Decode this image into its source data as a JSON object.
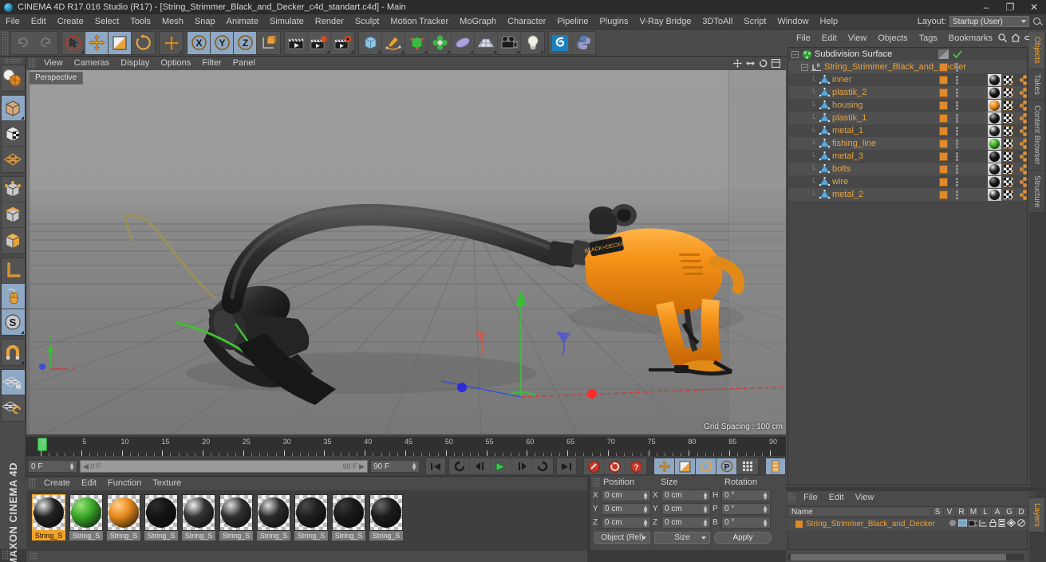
{
  "window": {
    "title": "CINEMA 4D R17.016 Studio (R17) - [String_Strimmer_Black_and_Decker_c4d_standart.c4d] - Main",
    "app_icon": "cinema4d-logo-icon",
    "minimize": "–",
    "maximize": "❐",
    "close": "✕"
  },
  "menubar": {
    "items": [
      "File",
      "Edit",
      "Create",
      "Select",
      "Tools",
      "Mesh",
      "Snap",
      "Animate",
      "Simulate",
      "Render",
      "Sculpt",
      "Motion Tracker",
      "MoGraph",
      "Character",
      "Pipeline",
      "Plugins",
      "V-Ray Bridge",
      "3DToAll",
      "Script",
      "Window",
      "Help"
    ],
    "layout_label": "Layout:",
    "layout_value": "Startup (User)"
  },
  "toolbar": {
    "groups": [
      {
        "name": "undo-redo",
        "buttons": [
          {
            "name": "undo-button",
            "icon": "undo-icon",
            "active": false,
            "disabled": true
          },
          {
            "name": "redo-button",
            "icon": "redo-icon",
            "active": false,
            "disabled": true
          }
        ]
      },
      {
        "name": "selection-transform",
        "buttons": [
          {
            "name": "live-selection-tool",
            "icon": "cursor-circle-icon",
            "active": false,
            "disabled": false
          },
          {
            "name": "move-tool",
            "icon": "move-arrows-icon",
            "active": true,
            "disabled": false
          },
          {
            "name": "scale-tool",
            "icon": "scale-box-icon",
            "active": true,
            "disabled": false
          },
          {
            "name": "rotate-tool",
            "icon": "rotate-circle-icon",
            "active": false,
            "disabled": false
          }
        ]
      },
      {
        "name": "world-axis",
        "buttons": [
          {
            "name": "global-local-toggle",
            "icon": "plus-axis-icon",
            "active": false,
            "disabled": false
          }
        ]
      },
      {
        "name": "axis-locks",
        "buttons": [
          {
            "name": "x-axis-lock",
            "icon": "x-axis-icon",
            "active": true,
            "disabled": false
          },
          {
            "name": "y-axis-lock",
            "icon": "y-axis-icon",
            "active": true,
            "disabled": false
          },
          {
            "name": "z-axis-lock",
            "icon": "z-axis-icon",
            "active": true,
            "disabled": false
          },
          {
            "name": "world-object-coord",
            "icon": "world-cube-icon",
            "active": false,
            "disabled": false
          }
        ]
      },
      {
        "name": "render",
        "buttons": [
          {
            "name": "render-view-button",
            "icon": "render-clapper-icon",
            "active": false,
            "disabled": false
          },
          {
            "name": "render-region-button",
            "icon": "render-region-icon",
            "active": false,
            "disabled": false
          },
          {
            "name": "render-settings-button",
            "icon": "render-settings-icon",
            "active": false,
            "disabled": false
          }
        ]
      },
      {
        "name": "create",
        "buttons": [
          {
            "name": "add-primitive-button",
            "icon": "cube-icon",
            "active": false,
            "disabled": false
          },
          {
            "name": "add-spline-button",
            "icon": "pen-spline-icon",
            "active": false,
            "disabled": false
          },
          {
            "name": "add-generator-button",
            "icon": "generator-icon",
            "active": false,
            "disabled": false
          },
          {
            "name": "add-mograph-button",
            "icon": "mograph-cloner-icon",
            "active": false,
            "disabled": false
          },
          {
            "name": "add-deformer-button",
            "icon": "deformer-icon",
            "active": false,
            "disabled": false
          },
          {
            "name": "add-scene-button",
            "icon": "floor-scene-icon",
            "active": false,
            "disabled": false
          },
          {
            "name": "add-camera-button",
            "icon": "camera-icon",
            "active": false,
            "disabled": false
          },
          {
            "name": "add-light-button",
            "icon": "light-bulb-icon",
            "active": false,
            "disabled": false
          }
        ]
      },
      {
        "name": "plugins",
        "buttons": [
          {
            "name": "content-browser-button",
            "icon": "c4d-swirl-icon",
            "active": false,
            "disabled": false
          },
          {
            "name": "python-button",
            "icon": "python-icon",
            "active": false,
            "disabled": false
          }
        ]
      }
    ]
  },
  "left_toolbar": {
    "groups": [
      {
        "name": "mode-group-1",
        "buttons": [
          {
            "name": "make-editable-button",
            "icon": "make-editable-icon",
            "active": false
          }
        ]
      },
      {
        "name": "mode-group-2",
        "buttons": [
          {
            "name": "model-mode-button",
            "icon": "model-cube-icon",
            "active": true
          },
          {
            "name": "texture-mode-button",
            "icon": "texture-cube-icon",
            "active": false
          },
          {
            "name": "uv-mode-button",
            "icon": "uv-mesh-icon",
            "active": false
          }
        ]
      },
      {
        "name": "component-group",
        "buttons": [
          {
            "name": "point-mode-button",
            "icon": "points-cube-icon",
            "active": false
          },
          {
            "name": "edge-mode-button",
            "icon": "edges-cube-icon",
            "active": false
          },
          {
            "name": "polygon-mode-button",
            "icon": "polygon-cube-icon",
            "active": false
          }
        ]
      },
      {
        "name": "axis-group",
        "buttons": [
          {
            "name": "enable-axis-button",
            "icon": "axis-L-icon",
            "active": false
          },
          {
            "name": "viewport-solo-button",
            "icon": "mouse-icon",
            "active": true
          },
          {
            "name": "workplane-button",
            "icon": "s-circle-icon",
            "active": true
          }
        ]
      },
      {
        "name": "snap-group",
        "buttons": [
          {
            "name": "enable-snap-button",
            "icon": "magnet-icon",
            "active": false
          }
        ]
      },
      {
        "name": "workplane-group",
        "buttons": [
          {
            "name": "lock-workplane-button",
            "icon": "grid-lock-icon",
            "active": true
          },
          {
            "name": "planar-workplane-button",
            "icon": "grid-rotate-icon",
            "active": false
          }
        ]
      }
    ],
    "brand": "MAXON CINEMA 4D"
  },
  "viewport": {
    "menu": [
      "View",
      "Cameras",
      "Display",
      "Options",
      "Filter",
      "Panel"
    ],
    "nav_icons": [
      "move-view-icon",
      "scale-view-icon",
      "rotate-view-icon",
      "maximize-view-icon"
    ],
    "camera_label": "Perspective",
    "grid_spacing": "Grid Spacing : 100 cm",
    "axis_gizmo": {
      "x": "X",
      "y": "Y",
      "z": "Z"
    },
    "scene_object": "String_Strimmer_Black_and_Decker",
    "colors": {
      "background_top": "#9b9b9b",
      "background_bottom": "#7c7c7c",
      "grid_line": "#6f6f6f",
      "x_axis": "#d23b3b",
      "y_axis": "#37c037",
      "z_axis": "#3b4fd2",
      "model_orange": "#f08a18",
      "model_black": "#2a2a2a"
    }
  },
  "timeline": {
    "ticks": [
      0,
      5,
      10,
      15,
      20,
      25,
      30,
      35,
      40,
      45,
      50,
      55,
      60,
      65,
      70,
      75,
      80,
      85,
      90
    ],
    "current_frame_field": "0 F",
    "range_start": "0 F",
    "range_end": "90 F",
    "end_frame_field": "90 F",
    "frame_field_right": "0 F",
    "transport": [
      {
        "name": "go-to-start-button",
        "icon": "skip-start-icon"
      },
      {
        "name": "play-backwards-button",
        "icon": "rewind-loop-icon"
      },
      {
        "name": "previous-frame-button",
        "icon": "step-back-icon"
      },
      {
        "name": "play-button",
        "icon": "play-icon"
      },
      {
        "name": "next-frame-button",
        "icon": "step-forward-icon"
      },
      {
        "name": "loop-button",
        "icon": "loop-icon"
      },
      {
        "name": "go-to-end-button",
        "icon": "skip-end-icon"
      }
    ],
    "record_buttons": [
      {
        "name": "record-keyframe-button",
        "icon": "record-key-icon"
      },
      {
        "name": "autokey-button",
        "icon": "autokey-icon"
      },
      {
        "name": "keyframe-selection-button",
        "icon": "key-question-icon"
      }
    ],
    "key_filter_buttons": [
      {
        "name": "position-key-button",
        "icon": "position-key-icon",
        "active": true
      },
      {
        "name": "scale-key-button",
        "icon": "scale-key-icon",
        "active": true
      },
      {
        "name": "rotation-key-button",
        "icon": "rotation-key-icon",
        "active": true
      },
      {
        "name": "param-key-button",
        "icon": "param-P-key-icon",
        "active": true
      },
      {
        "name": "pla-key-button",
        "icon": "point-level-anim-icon",
        "active": false
      }
    ],
    "timeline_toggle": {
      "name": "timeline-button",
      "icon": "timeline-icon"
    }
  },
  "material_manager": {
    "menu": [
      "Create",
      "Edit",
      "Function",
      "Texture"
    ],
    "materials": [
      {
        "name": "String_S",
        "color": "#232323",
        "highlight": "#e8e8e8",
        "selected": true
      },
      {
        "name": "String_S",
        "color": "#3aa829",
        "highlight": "#9ae37a",
        "selected": false
      },
      {
        "name": "String_S",
        "color": "#e88a1e",
        "highlight": "#ffd08a",
        "selected": false
      },
      {
        "name": "String_S",
        "color": "#141414",
        "highlight": "#2e2e2e",
        "selected": false
      },
      {
        "name": "String_S",
        "color": "#343434",
        "highlight": "#f0f0f0",
        "selected": false
      },
      {
        "name": "String_S",
        "color": "#303030",
        "highlight": "#e0e0e0",
        "selected": false
      },
      {
        "name": "String_S",
        "color": "#2c2c2c",
        "highlight": "#dcdcdc",
        "selected": false
      },
      {
        "name": "String_S",
        "color": "#1e1e1e",
        "highlight": "#4a4a4a",
        "selected": false
      },
      {
        "name": "String_S",
        "color": "#1a1a1a",
        "highlight": "#3a3a3a",
        "selected": false
      },
      {
        "name": "String_S",
        "color": "#1d1d1d",
        "highlight": "#6a6a6a",
        "selected": false
      }
    ]
  },
  "coordinates": {
    "headers": {
      "position": "Position",
      "size": "Size",
      "rotation": "Rotation"
    },
    "rows": [
      {
        "pos_axis": "X",
        "pos_value": "0 cm",
        "size_axis": "X",
        "size_value": "0 cm",
        "rot_axis": "H",
        "rot_value": "0 °"
      },
      {
        "pos_axis": "Y",
        "pos_value": "0 cm",
        "size_axis": "Y",
        "size_value": "0 cm",
        "rot_axis": "P",
        "rot_value": "0 °"
      },
      {
        "pos_axis": "Z",
        "pos_value": "0 cm",
        "size_axis": "Z",
        "size_value": "0 cm",
        "rot_axis": "B",
        "rot_value": "0 °"
      }
    ],
    "mode_dropdown": "Object (Rel)",
    "size_dropdown": "Size",
    "apply_button": "Apply"
  },
  "object_manager": {
    "menu": [
      "File",
      "Edit",
      "View",
      "Objects",
      "Tags",
      "Bookmarks"
    ],
    "header_icons": [
      "search-icon",
      "home-icon",
      "minus-icon",
      "layout-icon"
    ],
    "rows": [
      {
        "name": "Subdivision Surface",
        "depth": 0,
        "icon": "subdivision-surface-icon",
        "color": "white",
        "has_expander": true,
        "tag_orange": false,
        "tag_grey": true,
        "tag_check": true,
        "tags": []
      },
      {
        "name": "String_Strimmer_Black_and_Decker",
        "depth": 1,
        "icon": "null-layer-icon",
        "color": "orange",
        "has_expander": true,
        "tag_orange": true,
        "tag_grey": false,
        "tag_check": false,
        "tags": []
      },
      {
        "name": "inner",
        "depth": 2,
        "icon": "polygon-object-icon",
        "color": "orange",
        "has_expander": false,
        "tag_orange": true,
        "tags": [
          {
            "type": "material",
            "color": "#1c1c1c",
            "hl": "#d8d8d8"
          },
          {
            "type": "uv"
          },
          {
            "type": "phong"
          }
        ]
      },
      {
        "name": "plastik_2",
        "depth": 2,
        "icon": "polygon-object-icon",
        "color": "orange",
        "has_expander": false,
        "tag_orange": true,
        "tags": [
          {
            "type": "material",
            "color": "#141414",
            "hl": "#c0c0c0"
          },
          {
            "type": "uv"
          },
          {
            "type": "phong"
          }
        ]
      },
      {
        "name": "housing",
        "depth": 2,
        "icon": "polygon-object-icon",
        "color": "orange",
        "has_expander": false,
        "tag_orange": true,
        "tags": [
          {
            "type": "material",
            "color": "#e88a1e",
            "hl": "#ffd08a"
          },
          {
            "type": "uv"
          },
          {
            "type": "phong"
          }
        ]
      },
      {
        "name": "plastik_1",
        "depth": 2,
        "icon": "polygon-object-icon",
        "color": "orange",
        "has_expander": false,
        "tag_orange": true,
        "tags": [
          {
            "type": "material",
            "color": "#181818",
            "hl": "#b8b8b8"
          },
          {
            "type": "uv"
          },
          {
            "type": "phong"
          }
        ]
      },
      {
        "name": "metal_1",
        "depth": 2,
        "icon": "polygon-object-icon",
        "color": "orange",
        "has_expander": false,
        "tag_orange": true,
        "tags": [
          {
            "type": "material",
            "color": "#262626",
            "hl": "#ffffff"
          },
          {
            "type": "uv"
          },
          {
            "type": "phong"
          }
        ]
      },
      {
        "name": "fishing_line",
        "depth": 2,
        "icon": "polygon-object-icon",
        "color": "orange",
        "has_expander": false,
        "tag_orange": true,
        "tags": [
          {
            "type": "material",
            "color": "#3aa829",
            "hl": "#a8e888"
          },
          {
            "type": "uv"
          },
          {
            "type": "phong"
          }
        ]
      },
      {
        "name": "metal_3",
        "depth": 2,
        "icon": "polygon-object-icon",
        "color": "orange",
        "has_expander": false,
        "tag_orange": true,
        "tags": [
          {
            "type": "material",
            "color": "#111111",
            "hl": "#888888"
          },
          {
            "type": "uv"
          },
          {
            "type": "phong"
          }
        ]
      },
      {
        "name": "bolts",
        "depth": 2,
        "icon": "polygon-object-icon",
        "color": "orange",
        "has_expander": false,
        "tag_orange": true,
        "tags": [
          {
            "type": "material",
            "color": "#232323",
            "hl": "#f0f0f0"
          },
          {
            "type": "uv"
          },
          {
            "type": "phong"
          }
        ]
      },
      {
        "name": "wire",
        "depth": 2,
        "icon": "polygon-object-icon",
        "color": "orange",
        "has_expander": false,
        "tag_orange": true,
        "tags": [
          {
            "type": "material",
            "color": "#151515",
            "hl": "#909090"
          },
          {
            "type": "uv"
          },
          {
            "type": "phong"
          }
        ]
      },
      {
        "name": "metal_2",
        "depth": 2,
        "icon": "polygon-object-icon",
        "color": "orange",
        "has_expander": false,
        "tag_orange": true,
        "tags": [
          {
            "type": "material",
            "color": "#2a2a2a",
            "hl": "#ffffff"
          },
          {
            "type": "uv"
          },
          {
            "type": "phong"
          }
        ]
      }
    ],
    "side_tabs": [
      "Objects",
      "Takes",
      "Content Browser",
      "Structure"
    ],
    "active_side_tab": "Objects"
  },
  "layer_manager": {
    "menu": [
      "File",
      "Edit",
      "View"
    ],
    "name_column": "Name",
    "columns": [
      "S",
      "V",
      "R",
      "M",
      "L",
      "A",
      "G",
      "D"
    ],
    "rows": [
      {
        "name": "String_Strimmer_Black_and_Decker",
        "color": "#e08a2b"
      }
    ],
    "side_tab": "Layers"
  }
}
